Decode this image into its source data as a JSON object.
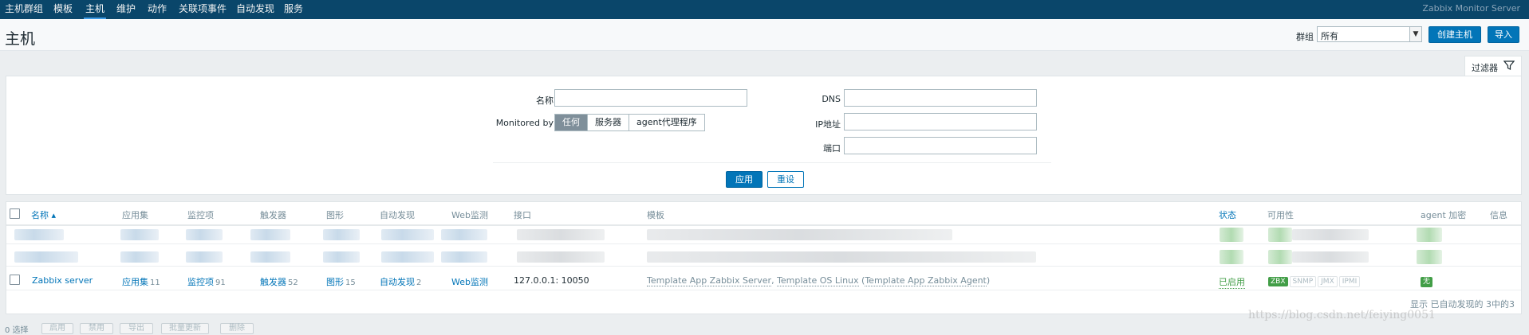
{
  "nav": {
    "items": [
      "主机群组",
      "模板",
      "主机",
      "维护",
      "动作",
      "关联项事件",
      "自动发现",
      "服务"
    ],
    "active": "主机",
    "brand": "Zabbix Monitor Server"
  },
  "header": {
    "title": "主机",
    "hostgroup_label": "群组",
    "hostgroup_value": "所有",
    "create_host": "创建主机",
    "import": "导入"
  },
  "filter": {
    "tab_label": "过滤器",
    "name_label": "名称",
    "monitored_by_label": "Monitored by",
    "monitored_by_options": [
      "任何",
      "服务器",
      "agent代理程序"
    ],
    "monitored_by_selected": "任何",
    "dns_label": "DNS",
    "ip_label": "IP地址",
    "port_label": "端口",
    "apply": "应用",
    "reset": "重设"
  },
  "table": {
    "columns": {
      "name": "名称 ▴",
      "applications": "应用集",
      "items": "监控项",
      "triggers": "触发器",
      "graphs": "图形",
      "discovery": "自动发现",
      "web": "Web监测",
      "interface": "接口",
      "templates": "模板",
      "status": "状态",
      "availability": "可用性",
      "agent_encryption": "agent 加密",
      "info": "信息"
    },
    "row": {
      "name": "Zabbix server",
      "applications": "应用集",
      "applications_count": "11",
      "items": "监控项",
      "items_count": "91",
      "triggers": "触发器",
      "triggers_count": "52",
      "graphs": "图形",
      "graphs_count": "15",
      "discovery": "自动发现",
      "discovery_count": "2",
      "web": "Web监测",
      "interface": "127.0.0.1: 10050",
      "template_1": "Template App Zabbix Server",
      "sep_1": ", ",
      "template_2": "Template OS Linux",
      "paren_open": " (",
      "template_3": "Template App Zabbix Agent",
      "paren_close": ")",
      "status": "已启用",
      "avail": [
        "ZBX",
        "SNMP",
        "JMX",
        "IPMI"
      ],
      "encryption": "无"
    },
    "footer": "显示 已自动发现的 3中的3"
  },
  "bottom": {
    "selected": "0 选择",
    "buttons": [
      "启用",
      "禁用",
      "导出",
      "批量更新",
      "删除"
    ]
  },
  "watermark": "https://blog.csdn.net/feiying0051"
}
